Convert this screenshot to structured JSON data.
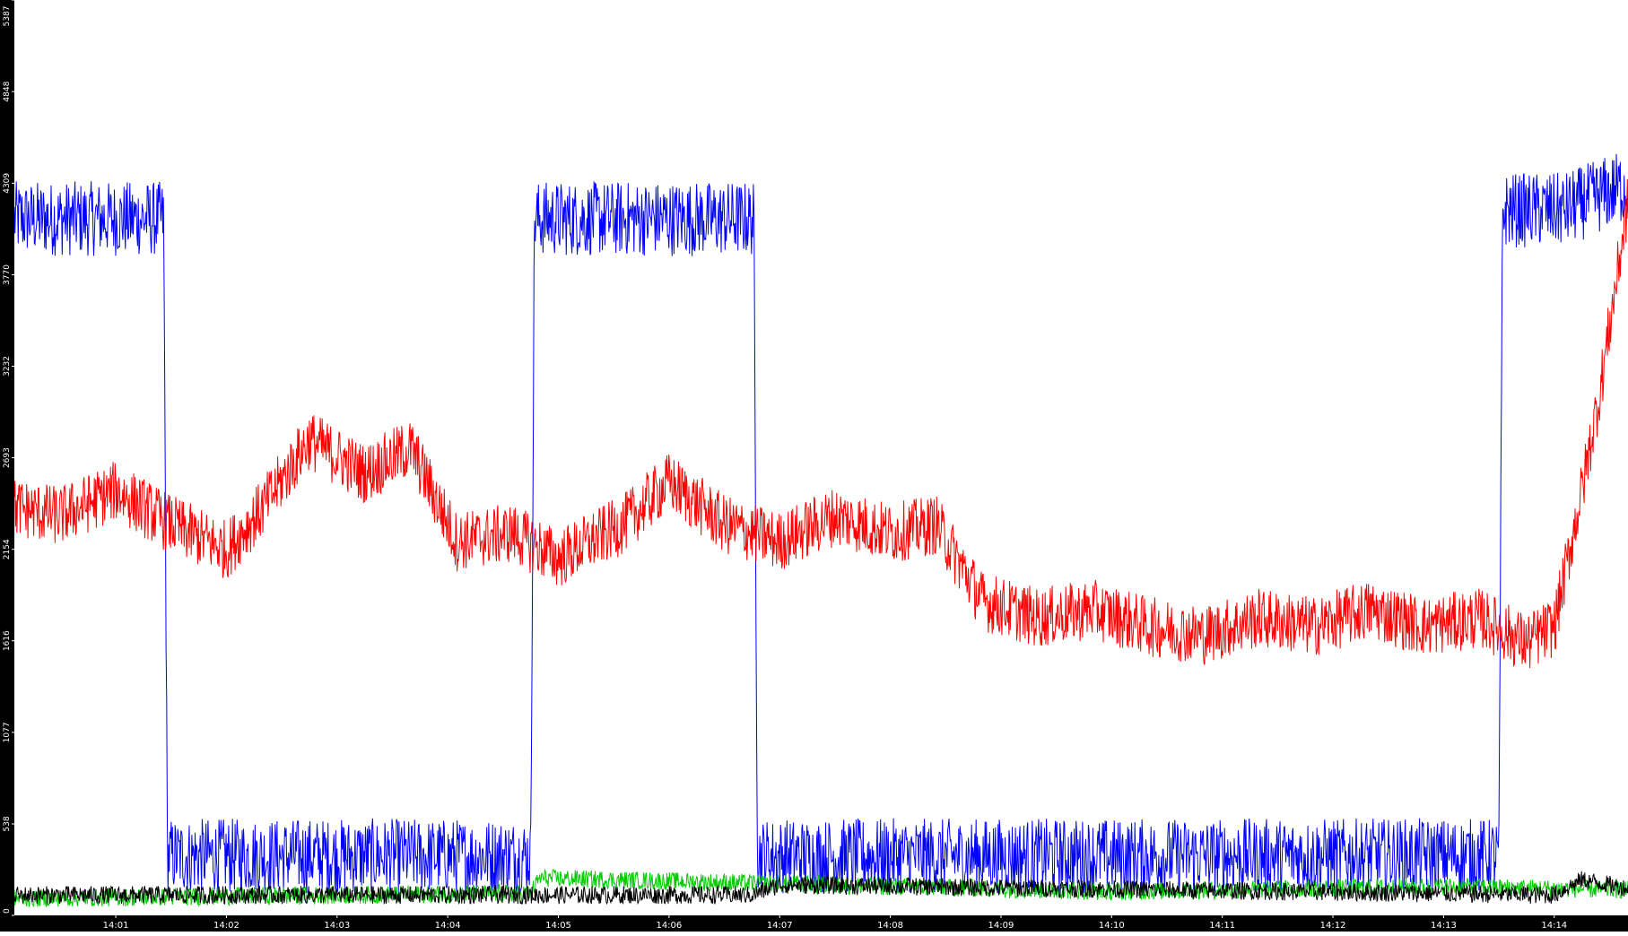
{
  "chart_data": {
    "type": "line",
    "title": "",
    "xlabel": "",
    "ylabel": "",
    "xlim": [
      "14:00:05",
      "14:14:40"
    ],
    "ylim": [
      0,
      5387
    ],
    "grid": false,
    "legend": "none",
    "x_tick_labels": [
      "14:01",
      "14:02",
      "14:03",
      "14:04",
      "14:05",
      "14:06",
      "14:07",
      "14:08",
      "14:09",
      "14:10",
      "14:11",
      "14:12",
      "14:13",
      "14:14"
    ],
    "y_tick_labels": [
      "0",
      "538",
      "1077",
      "1616",
      "2154",
      "2693",
      "3232",
      "3770",
      "4309",
      "4848",
      "5387"
    ],
    "axis_colors": {
      "background": "#000000",
      "text": "#ffffff"
    },
    "series": [
      {
        "color": "#0000ff",
        "x": [
          "14:00:05",
          "14:01:26",
          "14:01:28",
          "14:04:45",
          "14:04:47",
          "14:06:46",
          "14:06:48",
          "14:13:30",
          "14:13:32",
          "14:14:05",
          "14:14:40"
        ],
        "values": [
          4100,
          4100,
          350,
          350,
          4100,
          4100,
          350,
          350,
          4150,
          4150,
          4300
        ]
      },
      {
        "color": "#ff0000",
        "x": [
          "14:00:05",
          "14:00:30",
          "14:01:00",
          "14:01:30",
          "14:02:00",
          "14:02:20",
          "14:02:45",
          "14:03:15",
          "14:03:40",
          "14:04:05",
          "14:04:35",
          "14:05:00",
          "14:05:35",
          "14:06:00",
          "14:06:30",
          "14:07:00",
          "14:07:30",
          "14:08:00",
          "14:08:25",
          "14:08:50",
          "14:09:20",
          "14:09:50",
          "14:10:20",
          "14:10:50",
          "14:11:20",
          "14:11:50",
          "14:12:20",
          "14:12:50",
          "14:13:20",
          "14:13:45",
          "14:14:00",
          "14:14:15",
          "14:14:25",
          "14:14:40"
        ],
        "values": [
          2400,
          2350,
          2500,
          2300,
          2150,
          2400,
          2800,
          2600,
          2750,
          2200,
          2250,
          2100,
          2300,
          2550,
          2300,
          2200,
          2350,
          2250,
          2300,
          1850,
          1750,
          1800,
          1700,
          1650,
          1750,
          1700,
          1800,
          1700,
          1750,
          1600,
          1700,
          2500,
          3100,
          4200
        ]
      },
      {
        "color": "#00cc00",
        "x": [
          "14:00:05",
          "14:04:45",
          "14:04:50",
          "14:10:00",
          "14:13:00",
          "14:14:40"
        ],
        "values": [
          100,
          130,
          220,
          140,
          170,
          150
        ]
      },
      {
        "color": "#000000",
        "x": [
          "14:00:05",
          "14:06:45",
          "14:07:00",
          "14:14:00",
          "14:14:15",
          "14:14:40"
        ],
        "values": [
          120,
          120,
          180,
          120,
          210,
          160
        ]
      }
    ]
  }
}
